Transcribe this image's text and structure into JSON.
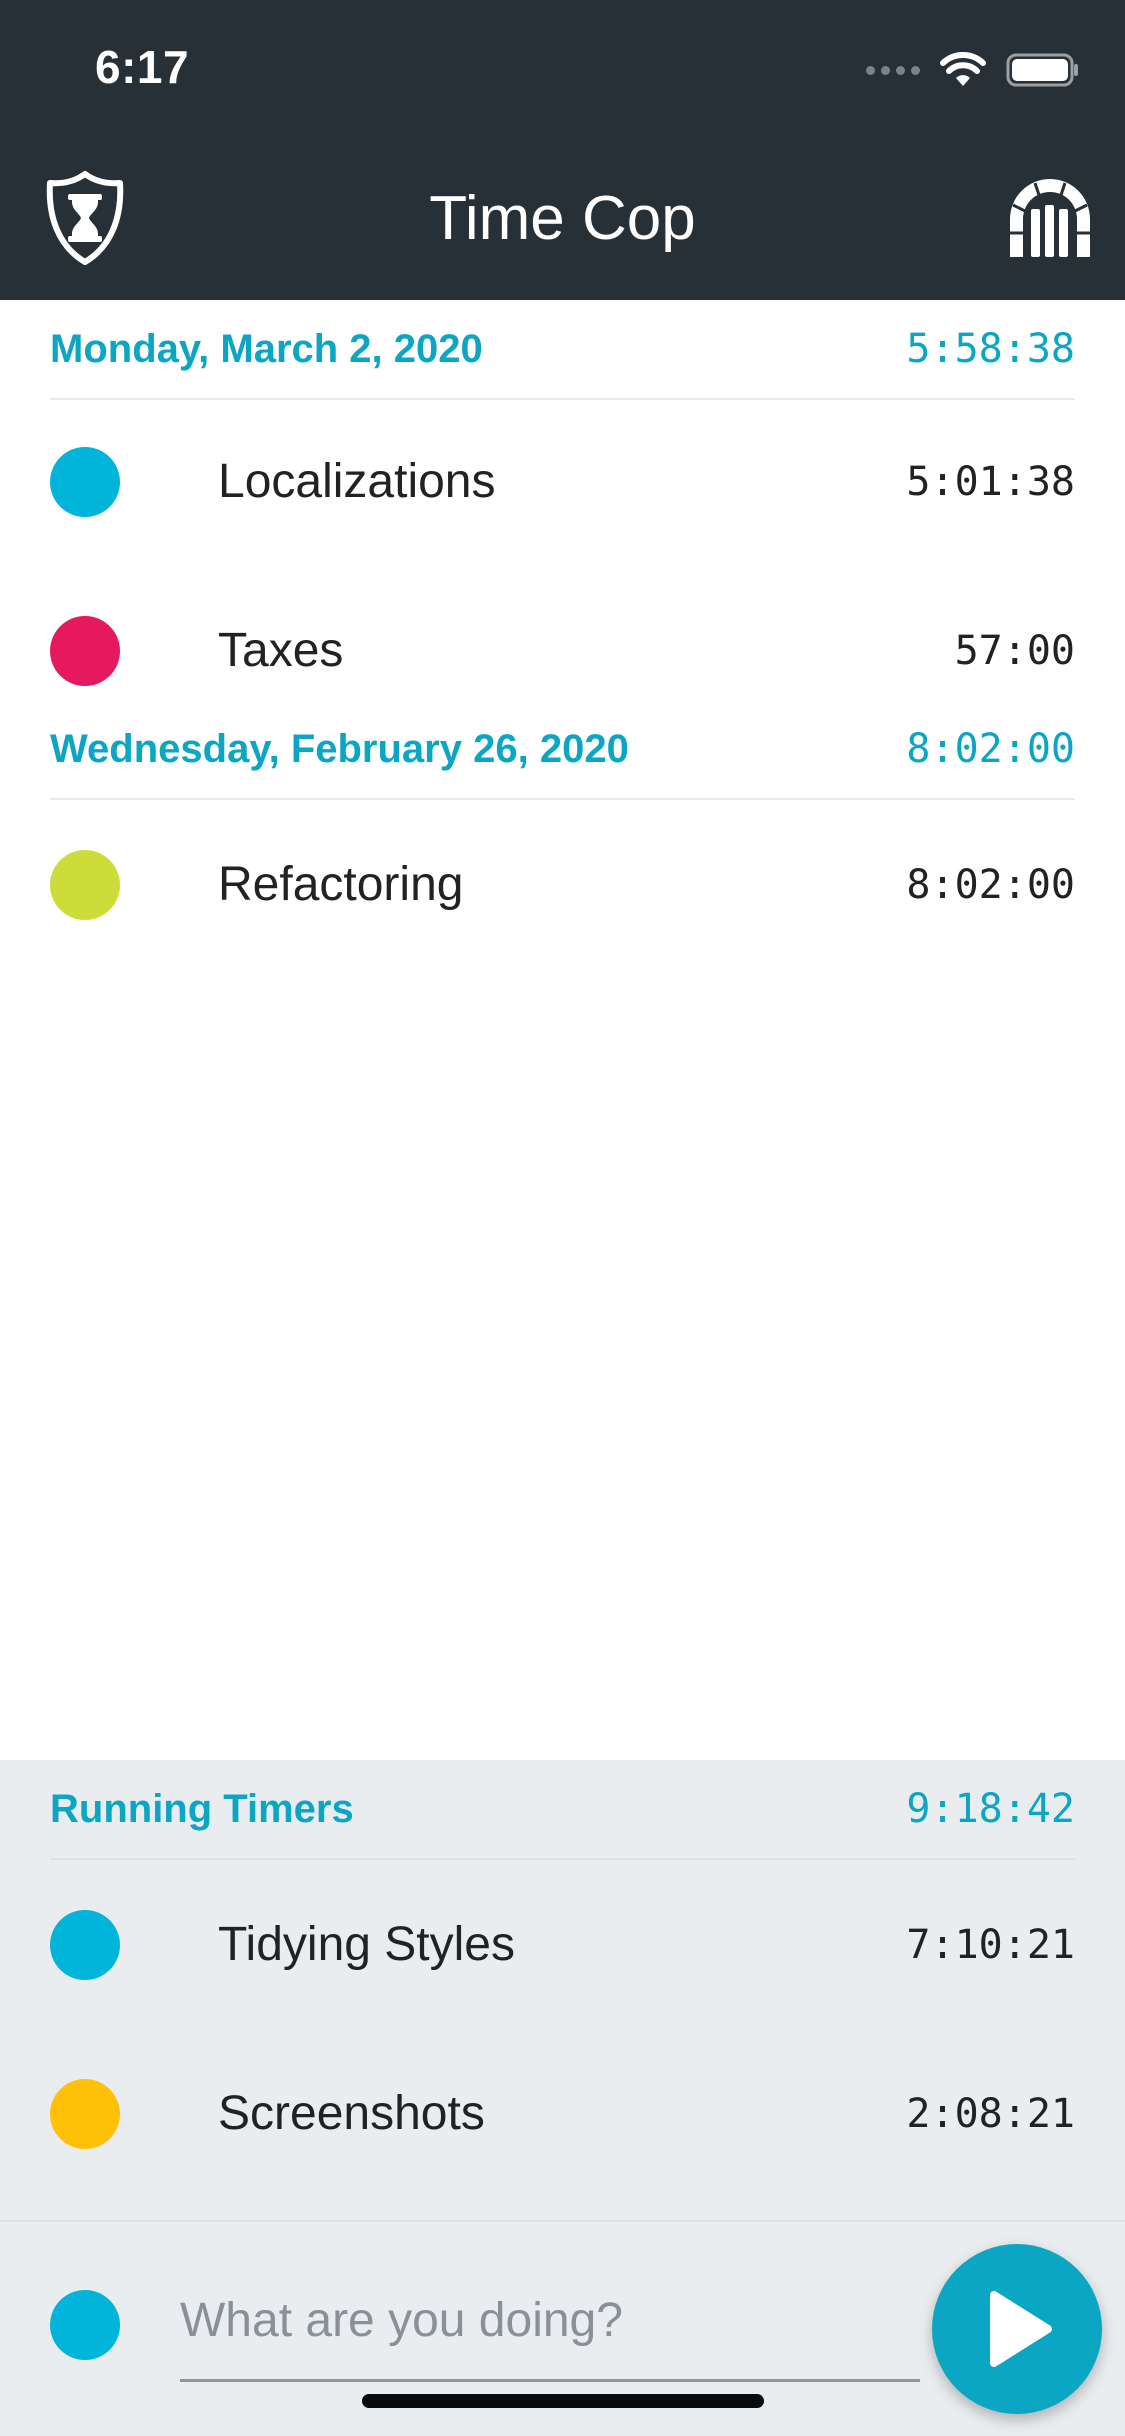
{
  "status_bar": {
    "time": "6:17"
  },
  "header": {
    "title": "Time Cop"
  },
  "colors": {
    "accent": "#0aa6c3",
    "header_bg": "#272f37",
    "cyan": "#00b5d9",
    "pink": "#e6195f",
    "lime": "#cddc39",
    "amber": "#ffc107"
  },
  "groups": [
    {
      "date": "Monday, March 2, 2020",
      "total": "5:58:38",
      "entries": [
        {
          "name": "Localizations",
          "duration": "5:01:38",
          "color": "#00b5d9"
        },
        {
          "name": "Taxes",
          "duration": "57:00",
          "color": "#e6195f"
        }
      ]
    },
    {
      "date": "Wednesday, February 26, 2020",
      "total": "8:02:00",
      "entries": [
        {
          "name": "Refactoring",
          "duration": "8:02:00",
          "color": "#cddc39"
        }
      ]
    }
  ],
  "running": {
    "label": "Running Timers",
    "total": "9:18:42",
    "timers": [
      {
        "name": "Tidying Styles",
        "duration": "7:10:21",
        "color": "#00b5d9"
      },
      {
        "name": "Screenshots",
        "duration": "2:08:21",
        "color": "#ffc107"
      }
    ]
  },
  "new_timer": {
    "placeholder": "What are you doing?",
    "color": "#00b5d9"
  },
  "icons": {
    "shield": "shield-hourglass-icon",
    "archive": "archive-icon",
    "play": "play-icon"
  }
}
